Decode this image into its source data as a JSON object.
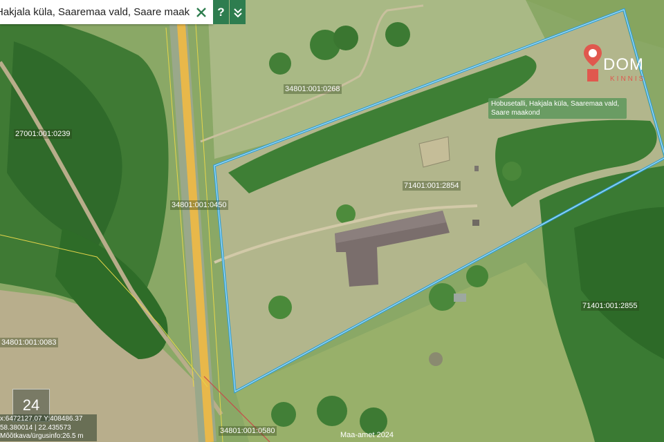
{
  "search": {
    "value": "Hakjala küla, Saaremaa vald, Saare maakond"
  },
  "controls": {
    "help_label": "?",
    "expand_label": "⌄⌄"
  },
  "parcels": [
    {
      "id": "34801:001:0268"
    },
    {
      "id": "27001:001:0239"
    },
    {
      "id": "34801:001:0450"
    },
    {
      "id": "71401:001:2854"
    },
    {
      "id": "71401:001:2855"
    },
    {
      "id": "34801:001:0083"
    },
    {
      "id": "34801:001:0580"
    }
  ],
  "popup": {
    "text": "Hobusetalli, Hakjala küla, Saaremaa vald, Saare maakond"
  },
  "logo": {
    "text": "DOM",
    "subtext": "KINNIS",
    "pin_color": "#e0584e"
  },
  "zoom": {
    "level": "24"
  },
  "coords": {
    "line1": "x:6472127.07 Y:408486.37",
    "line2": "58.380014 | 22.435573",
    "line3": "Mõõtkava/ürgusinfo:26.5 m"
  },
  "attribution": "Maa-amet 2024",
  "colors": {
    "boundary": "#2f9fd6",
    "control_bg": "#2e7d4f",
    "road": "#e8b84a"
  }
}
